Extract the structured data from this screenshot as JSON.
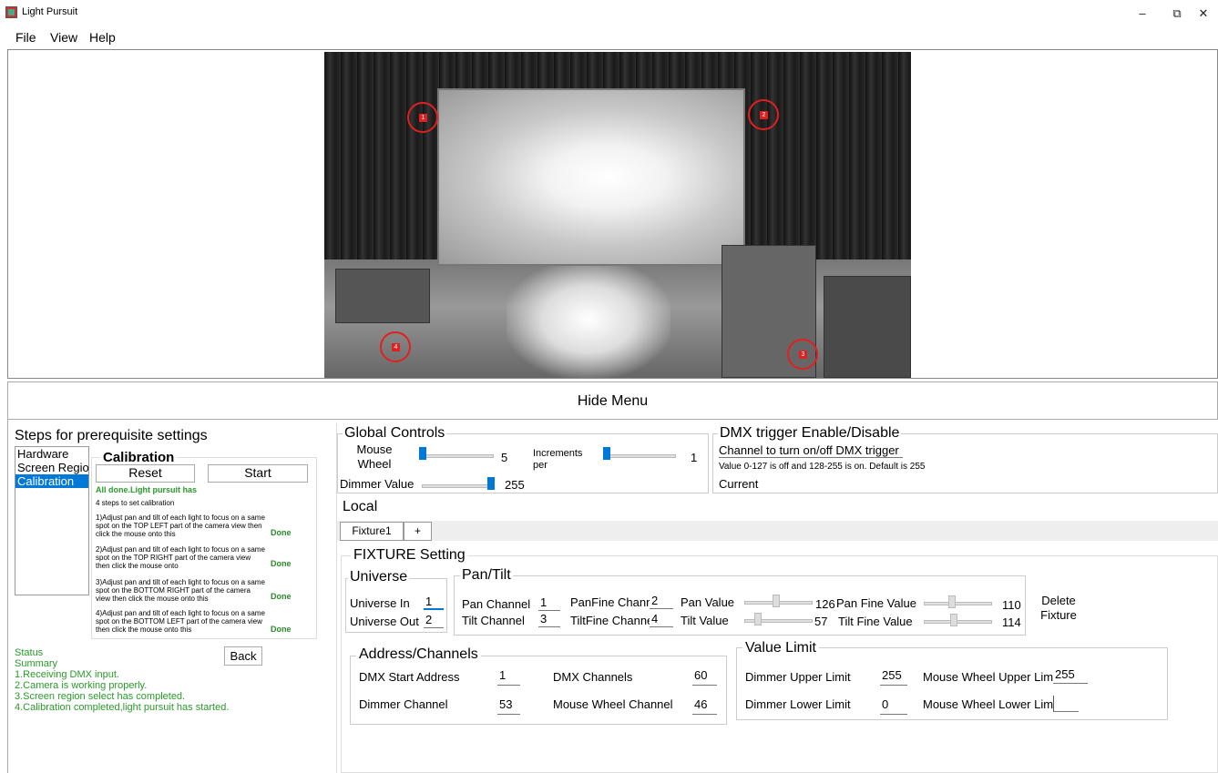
{
  "window": {
    "title": "Light Pursuit",
    "min_icon": "minimize-icon",
    "max_icon": "restore-icon",
    "close_icon": "close-icon",
    "min": "–",
    "max": "⧉",
    "close": "✕"
  },
  "menu": {
    "file": "File",
    "view": "View",
    "help": "Help"
  },
  "camera": {
    "markers": [
      "1",
      "2",
      "3",
      "4"
    ]
  },
  "hide_menu": "Hide Menu",
  "steps": {
    "title": "Steps for prerequisite settings",
    "list": [
      "Hardware",
      "Screen Regio",
      "Calibration"
    ],
    "selected": "Calibration",
    "calibration_title": "Calibration",
    "reset": "Reset",
    "start": "Start",
    "all_done": "All done.Light pursuit has",
    "steps_heading": "4 steps to set calibration",
    "items": [
      {
        "text": "1)Adjust pan and tilt of each light to focus on a same spot on the TOP LEFT part of the camera view then click the mouse onto this",
        "status": "Done"
      },
      {
        "text": "2)Adjust pan and tilt of each light to focus on a same spot on the TOP RIGHT part of the camera view then click the mouse onto",
        "status": "Done"
      },
      {
        "text": "3)Adjust pan and tilt of each light to focus on a same spot on the BOTTOM RIGHT part of the camera view then click the mouse onto this",
        "status": "Done"
      },
      {
        "text": "4)Adjust pan and tilt of each light to focus on a same spot on the BOTTOM LEFT part of the camera view then click the mouse onto this",
        "status": "Done"
      }
    ],
    "back": "Back",
    "status_label": "Status",
    "summary_label": "Summary",
    "summary": [
      "1.Receiving DMX input.",
      "2.Camera is working properly.",
      "3.Screen region select has completed.",
      "4.Calibration completed,light pursuit has started."
    ]
  },
  "global": {
    "title": "Global Controls",
    "mouse_wheel": "Mouse\nWheel",
    "mouse_wheel_l1": "Mouse",
    "mouse_wheel_l2": "Wheel",
    "mouse_wheel_value": "5",
    "increments_l1": "Increments",
    "increments_l2": "per",
    "increments_value": "1",
    "dimmer_label": "Dimmer Value",
    "dimmer_value": "255"
  },
  "dmx": {
    "title": "DMX trigger Enable/Disable",
    "channel_label": "Channel to turn on/off DMX trigger",
    "note": "Value 0-127 is off and 128-255 is on. Default is 255",
    "current": "Current"
  },
  "local": "Local",
  "tabs": [
    "Fixture1",
    "+"
  ],
  "fixture": {
    "title": "FIXTURE Setting",
    "universe_title": "Universe",
    "universe_in_label": "Universe In",
    "universe_in": "1",
    "universe_out_label": "Universe Out",
    "universe_out": "2",
    "pantilt_title": "Pan/Tilt",
    "pan_channel_label": "Pan Channel",
    "pan_channel": "1",
    "tilt_channel_label": "Tilt Channel",
    "tilt_channel": "3",
    "panfine_label": "PanFine Chanr",
    "panfine": "2",
    "tiltfine_label": "TiltFine Channe",
    "tiltfine": "4",
    "pan_value_label": "Pan Value",
    "pan_value": "126",
    "tilt_value_label": "Tilt Value",
    "tilt_value": "57",
    "pan_fine_label": "Pan Fine Value",
    "pan_fine": "110",
    "tilt_fine_label": "Tilt Fine Value",
    "tilt_fine": "114",
    "delete_l1": "Delete",
    "delete_l2": "Fixture",
    "address_title": "Address/Channels",
    "dmx_start_label": "DMX Start Address",
    "dmx_start": "1",
    "dmx_channels_label": "DMX Channels",
    "dmx_channels": "60",
    "dimmer_channel_label": "Dimmer Channel",
    "dimmer_channel": "53",
    "mw_channel_label": "Mouse Wheel Channel",
    "mw_channel": "46",
    "limit_title": "Value Limit",
    "dim_upper_label": "Dimmer Upper Limit",
    "dim_upper": "255",
    "dim_lower_label": "Dimmer Lower Limit",
    "dim_lower": "0",
    "mw_upper_label": "Mouse Wheel Upper Limi",
    "mw_upper": "255",
    "mw_lower_label": "Mouse Wheel Lower Limit",
    "mw_lower": ""
  },
  "colors": {
    "accent": "#0078d7",
    "status_green": "#2a9a2a",
    "marker_red": "#e02020"
  }
}
